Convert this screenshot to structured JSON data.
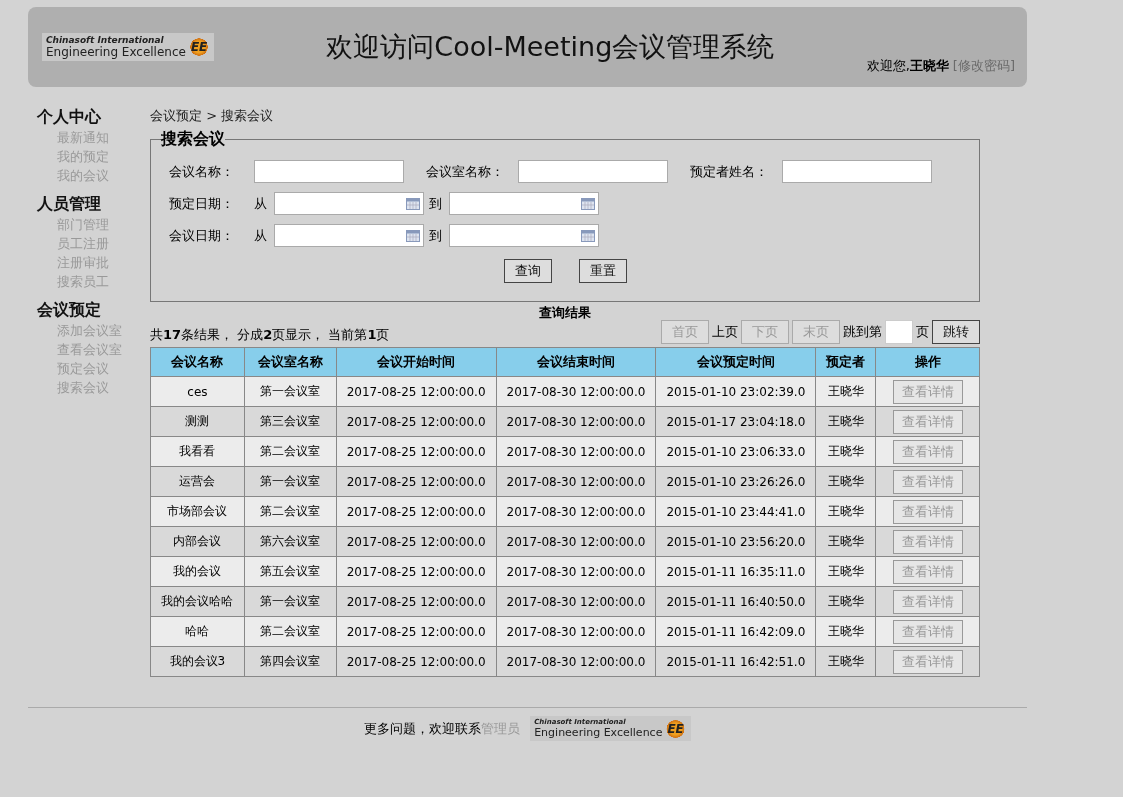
{
  "header": {
    "logo": {
      "line1": "Chinasoft International",
      "line2": "Engineering Excellence",
      "mark": "EE"
    },
    "title": "欢迎访问Cool-Meeting会议管理系统",
    "welcome": "欢迎您,",
    "user": "王晓华",
    "change_password": "[修改密码]"
  },
  "sidebar": [
    {
      "title": "个人中心",
      "items": [
        "最新通知",
        "我的预定",
        "我的会议"
      ]
    },
    {
      "title": "人员管理",
      "items": [
        "部门管理",
        "员工注册",
        "注册审批",
        "搜索员工"
      ]
    },
    {
      "title": "会议预定",
      "items": [
        "添加会议室",
        "查看会议室",
        "预定会议",
        "搜索会议"
      ]
    }
  ],
  "breadcrumb": "会议预定 > 搜索会议",
  "search": {
    "legend": "搜索会议",
    "text_fields": [
      {
        "label": "会议名称："
      },
      {
        "label": "会议室名称："
      },
      {
        "label": "预定者姓名："
      }
    ],
    "date_rows": [
      {
        "label": "预定日期：",
        "from": "从",
        "to": "到"
      },
      {
        "label": "会议日期：",
        "from": "从",
        "to": "到"
      }
    ],
    "buttons": [
      "查询",
      "重置"
    ]
  },
  "results": {
    "caption": "查询结果",
    "summary": "共**17**条结果， 分成**2**页显示， 当前第**1**页",
    "pager": [
      {
        "kind": "button",
        "label": "首页",
        "disabled": true
      },
      {
        "kind": "text",
        "label": "上页"
      },
      {
        "kind": "button",
        "label": "下页",
        "disabled": true
      },
      {
        "kind": "button",
        "label": "末页",
        "disabled": true
      },
      {
        "kind": "text",
        "label": "跳到第"
      },
      {
        "kind": "input"
      },
      {
        "kind": "text",
        "label": "页"
      },
      {
        "kind": "button",
        "label": "跳转",
        "disabled": false
      }
    ],
    "columns": [
      "会议名称",
      "会议室名称",
      "会议开始时间",
      "会议结束时间",
      "会议预定时间",
      "预定者",
      "操作"
    ],
    "rows": [
      {
        "cells": [
          "ces",
          "第一会议室",
          "2017-08-25 12:00:00.0",
          "2017-08-30 12:00:00.0",
          "2015-01-10 23:02:39.0",
          "王晓华"
        ],
        "action": "查看详情"
      },
      {
        "cells": [
          "测测",
          "第三会议室",
          "2017-08-25 12:00:00.0",
          "2017-08-30 12:00:00.0",
          "2015-01-17 23:04:18.0",
          "王晓华"
        ],
        "action": "查看详情"
      },
      {
        "cells": [
          "我看看",
          "第二会议室",
          "2017-08-25 12:00:00.0",
          "2017-08-30 12:00:00.0",
          "2015-01-10 23:06:33.0",
          "王晓华"
        ],
        "action": "查看详情"
      },
      {
        "cells": [
          "运营会",
          "第一会议室",
          "2017-08-25 12:00:00.0",
          "2017-08-30 12:00:00.0",
          "2015-01-10 23:26:26.0",
          "王晓华"
        ],
        "action": "查看详情"
      },
      {
        "cells": [
          "市场部会议",
          "第二会议室",
          "2017-08-25 12:00:00.0",
          "2017-08-30 12:00:00.0",
          "2015-01-10 23:44:41.0",
          "王晓华"
        ],
        "action": "查看详情"
      },
      {
        "cells": [
          "内部会议",
          "第六会议室",
          "2017-08-25 12:00:00.0",
          "2017-08-30 12:00:00.0",
          "2015-01-10 23:56:20.0",
          "王晓华"
        ],
        "action": "查看详情"
      },
      {
        "cells": [
          "我的会议",
          "第五会议室",
          "2017-08-25 12:00:00.0",
          "2017-08-30 12:00:00.0",
          "2015-01-11 16:35:11.0",
          "王晓华"
        ],
        "action": "查看详情"
      },
      {
        "cells": [
          "我的会议哈哈",
          "第一会议室",
          "2017-08-25 12:00:00.0",
          "2017-08-30 12:00:00.0",
          "2015-01-11 16:40:50.0",
          "王晓华"
        ],
        "action": "查看详情"
      },
      {
        "cells": [
          "哈哈",
          "第二会议室",
          "2017-08-25 12:00:00.0",
          "2017-08-30 12:00:00.0",
          "2015-01-11 16:42:09.0",
          "王晓华"
        ],
        "action": "查看详情"
      },
      {
        "cells": [
          "我的会议3",
          "第四会议室",
          "2017-08-25 12:00:00.0",
          "2017-08-30 12:00:00.0",
          "2015-01-11 16:42:51.0",
          "王晓华"
        ],
        "action": "查看详情"
      }
    ]
  },
  "footer": {
    "text": "更多问题，欢迎联系",
    "link": "管理员",
    "logo": {
      "line1": "Chinasoft International",
      "line2": "Engineering Excellence",
      "mark": "EE"
    }
  }
}
